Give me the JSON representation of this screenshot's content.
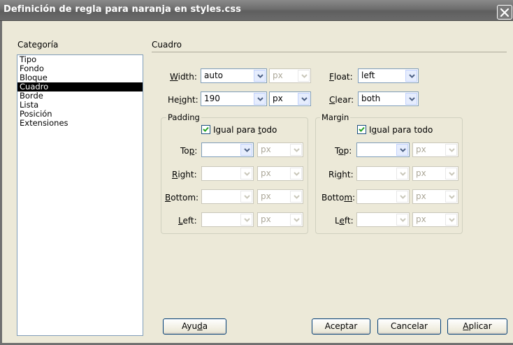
{
  "window": {
    "title": "Definición de regla para naranja en styles.css",
    "close_icon": "close-icon"
  },
  "category_panel": {
    "heading": "Categoría",
    "items": [
      "Tipo",
      "Fondo",
      "Bloque",
      "Cuadro",
      "Borde",
      "Lista",
      "Posición",
      "Extensiones"
    ],
    "selected": "Cuadro"
  },
  "section": {
    "title": "Cuadro"
  },
  "box": {
    "width": {
      "label_pre": "",
      "label_key": "W",
      "label_post": "idth:",
      "value": "auto",
      "unit": "px",
      "unit_enabled": false
    },
    "height": {
      "label_pre": "He",
      "label_key": "i",
      "label_post": "ght:",
      "value": "190",
      "unit": "px",
      "unit_enabled": true
    },
    "float": {
      "label_pre": "",
      "label_key": "F",
      "label_post": "loat:",
      "value": "left"
    },
    "clear": {
      "label_pre": "",
      "label_key": "C",
      "label_post": "lear:",
      "value": "both"
    }
  },
  "padding": {
    "legend": "Padding",
    "same_for_all": {
      "pre": "Igual para ",
      "key": "t",
      "post": "odo",
      "checked": true
    },
    "rows": [
      {
        "pre": "To",
        "key": "p",
        "post": ":",
        "value": "",
        "unit": "px",
        "enabled": true
      },
      {
        "pre": "",
        "key": "R",
        "post": "ight:",
        "value": "",
        "unit": "px",
        "enabled": false
      },
      {
        "pre": "",
        "key": "B",
        "post": "ottom:",
        "value": "",
        "unit": "px",
        "enabled": false
      },
      {
        "pre": "",
        "key": "L",
        "post": "eft:",
        "value": "",
        "unit": "px",
        "enabled": false
      }
    ]
  },
  "margin": {
    "legend": "Margin",
    "same_for_all": {
      "pre": "I",
      "key": "g",
      "post": "ual para todo",
      "checked": true
    },
    "rows": [
      {
        "pre": "T",
        "key": "o",
        "post": "p:",
        "value": "",
        "unit": "px",
        "enabled": true
      },
      {
        "pre": "Ri",
        "key": "g",
        "post": "ht:",
        "value": "",
        "unit": "px",
        "enabled": false
      },
      {
        "pre": "Botto",
        "key": "m",
        "post": ":",
        "value": "",
        "unit": "px",
        "enabled": false
      },
      {
        "pre": "L",
        "key": "e",
        "post": "ft:",
        "value": "",
        "unit": "px",
        "enabled": false
      }
    ]
  },
  "buttons": {
    "help": {
      "pre": "Ayu",
      "key": "d",
      "post": "a"
    },
    "ok": {
      "pre": "Aceptar",
      "key": "",
      "post": ""
    },
    "cancel": {
      "pre": "Cancelar",
      "key": "",
      "post": ""
    },
    "apply": {
      "pre": "",
      "key": "A",
      "post": "plicar"
    }
  },
  "icons": {
    "dropdown": "chevron-down-icon",
    "checkbox": "checkmark-icon"
  }
}
